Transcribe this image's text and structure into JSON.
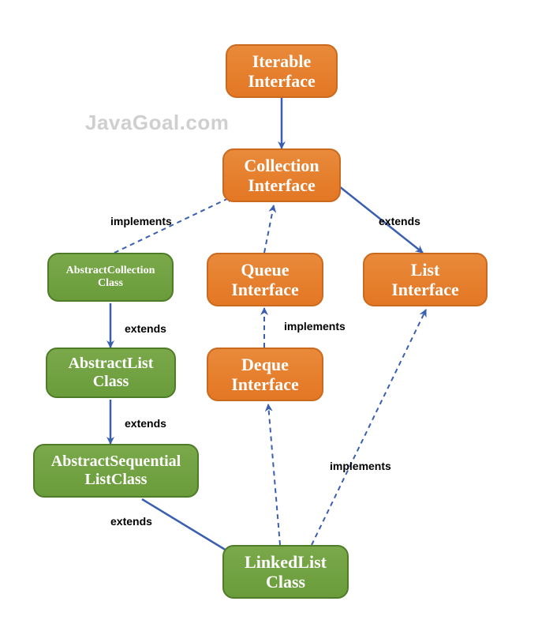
{
  "watermark": "JavaGoal.com",
  "nodes": {
    "iterable": {
      "l1": "Iterable",
      "l2": "Interface"
    },
    "collection": {
      "l1": "Collection",
      "l2": "Interface"
    },
    "queue": {
      "l1": "Queue",
      "l2": "Interface"
    },
    "list": {
      "l1": "List",
      "l2": "Interface"
    },
    "deque": {
      "l1": "Deque",
      "l2": "Interface"
    },
    "abscoll": {
      "l1": "AbstractCollection",
      "l2": "Class"
    },
    "abslist": {
      "l1": "AbstractList",
      "l2": "Class"
    },
    "absseq": {
      "l1": "AbstractSequential",
      "l2": "ListClass"
    },
    "linked": {
      "l1": "LinkedList",
      "l2": "Class"
    }
  },
  "labels": {
    "implements": "implements",
    "extends": "extends"
  },
  "chart_data": {
    "type": "table",
    "nodes": [
      {
        "id": "Iterable Interface",
        "kind": "interface"
      },
      {
        "id": "Collection Interface",
        "kind": "interface"
      },
      {
        "id": "Queue Interface",
        "kind": "interface"
      },
      {
        "id": "List Interface",
        "kind": "interface"
      },
      {
        "id": "Deque Interface",
        "kind": "interface"
      },
      {
        "id": "AbstractCollection Class",
        "kind": "class"
      },
      {
        "id": "AbstractList Class",
        "kind": "class"
      },
      {
        "id": "AbstractSequentialList Class",
        "kind": "class"
      },
      {
        "id": "LinkedList Class",
        "kind": "class"
      }
    ],
    "edges": [
      {
        "from": "Iterable Interface",
        "to": "Collection Interface",
        "rel": "extends-down"
      },
      {
        "from": "Collection Interface",
        "to": "List Interface",
        "rel": "extends"
      },
      {
        "from": "AbstractCollection Class",
        "to": "Collection Interface",
        "rel": "implements"
      },
      {
        "from": "Queue Interface",
        "to": "Collection Interface",
        "rel": "extends"
      },
      {
        "from": "AbstractList Class",
        "to": "AbstractCollection Class",
        "rel": "extends"
      },
      {
        "from": "Deque Interface",
        "to": "Queue Interface",
        "rel": "implements"
      },
      {
        "from": "AbstractSequentialList Class",
        "to": "AbstractList Class",
        "rel": "extends"
      },
      {
        "from": "LinkedList Class",
        "to": "AbstractSequentialList Class",
        "rel": "extends"
      },
      {
        "from": "LinkedList Class",
        "to": "Deque Interface",
        "rel": "implements"
      },
      {
        "from": "LinkedList Class",
        "to": "List Interface",
        "rel": "implements"
      }
    ]
  }
}
